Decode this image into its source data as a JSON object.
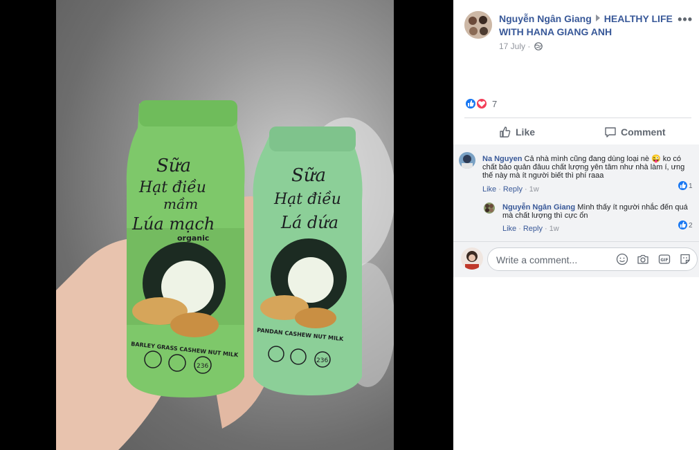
{
  "post": {
    "author": "Nguyễn Ngân Giang",
    "group": "HEALTHY LIFE WITH HANA GIANG ANH",
    "date": "17 July",
    "reaction_count": "7",
    "actions": {
      "like": "Like",
      "comment": "Comment"
    },
    "photo": {
      "bottle_left": {
        "title_lines": [
          "Sữa",
          "Hạt điều",
          "mầm",
          "Lúa mạch"
        ],
        "tag": "organic",
        "subtitle": "BARLEY GRASS CASHEW NUT MILK",
        "volume": "236"
      },
      "bottle_right": {
        "title_lines": [
          "Sữa",
          "Hạt điều",
          "Lá dứa"
        ],
        "subtitle": "PANDAN CASHEW NUT MILK",
        "volume": "236"
      }
    }
  },
  "comments": [
    {
      "author": "Na Nguyen",
      "text": "Cả nhà mình cũng đang dùng loại nè 😜 ko có chất bảo quản đâuu chất lượng yên tâm như nhà làm í, ưng thế này mà ít người biết thì phí raaa",
      "like": "Like",
      "reply": "Reply",
      "time": "1w",
      "likes": "1"
    },
    {
      "author": "Nguyễn Ngân Giang",
      "text": "Mình thấy ít người nhắc đến quá mà chất lượng thì cực ổn",
      "like": "Like",
      "reply": "Reply",
      "time": "1w",
      "likes": "2"
    }
  ],
  "composer": {
    "placeholder": "Write a comment..."
  },
  "icons": {
    "more": "more-options-icon",
    "globe": "globe-icon",
    "like_reaction": "like-reaction-icon",
    "love_reaction": "love-reaction-icon",
    "emoji": "emoji-icon",
    "camera": "camera-icon",
    "gif": "gif-icon",
    "sticker": "sticker-icon"
  },
  "colors": {
    "link": "#385898",
    "like_blue": "#1877f2",
    "love_red": "#f33e58",
    "bottle_left": "#7ec86a",
    "bottle_right": "#8ccf98"
  }
}
